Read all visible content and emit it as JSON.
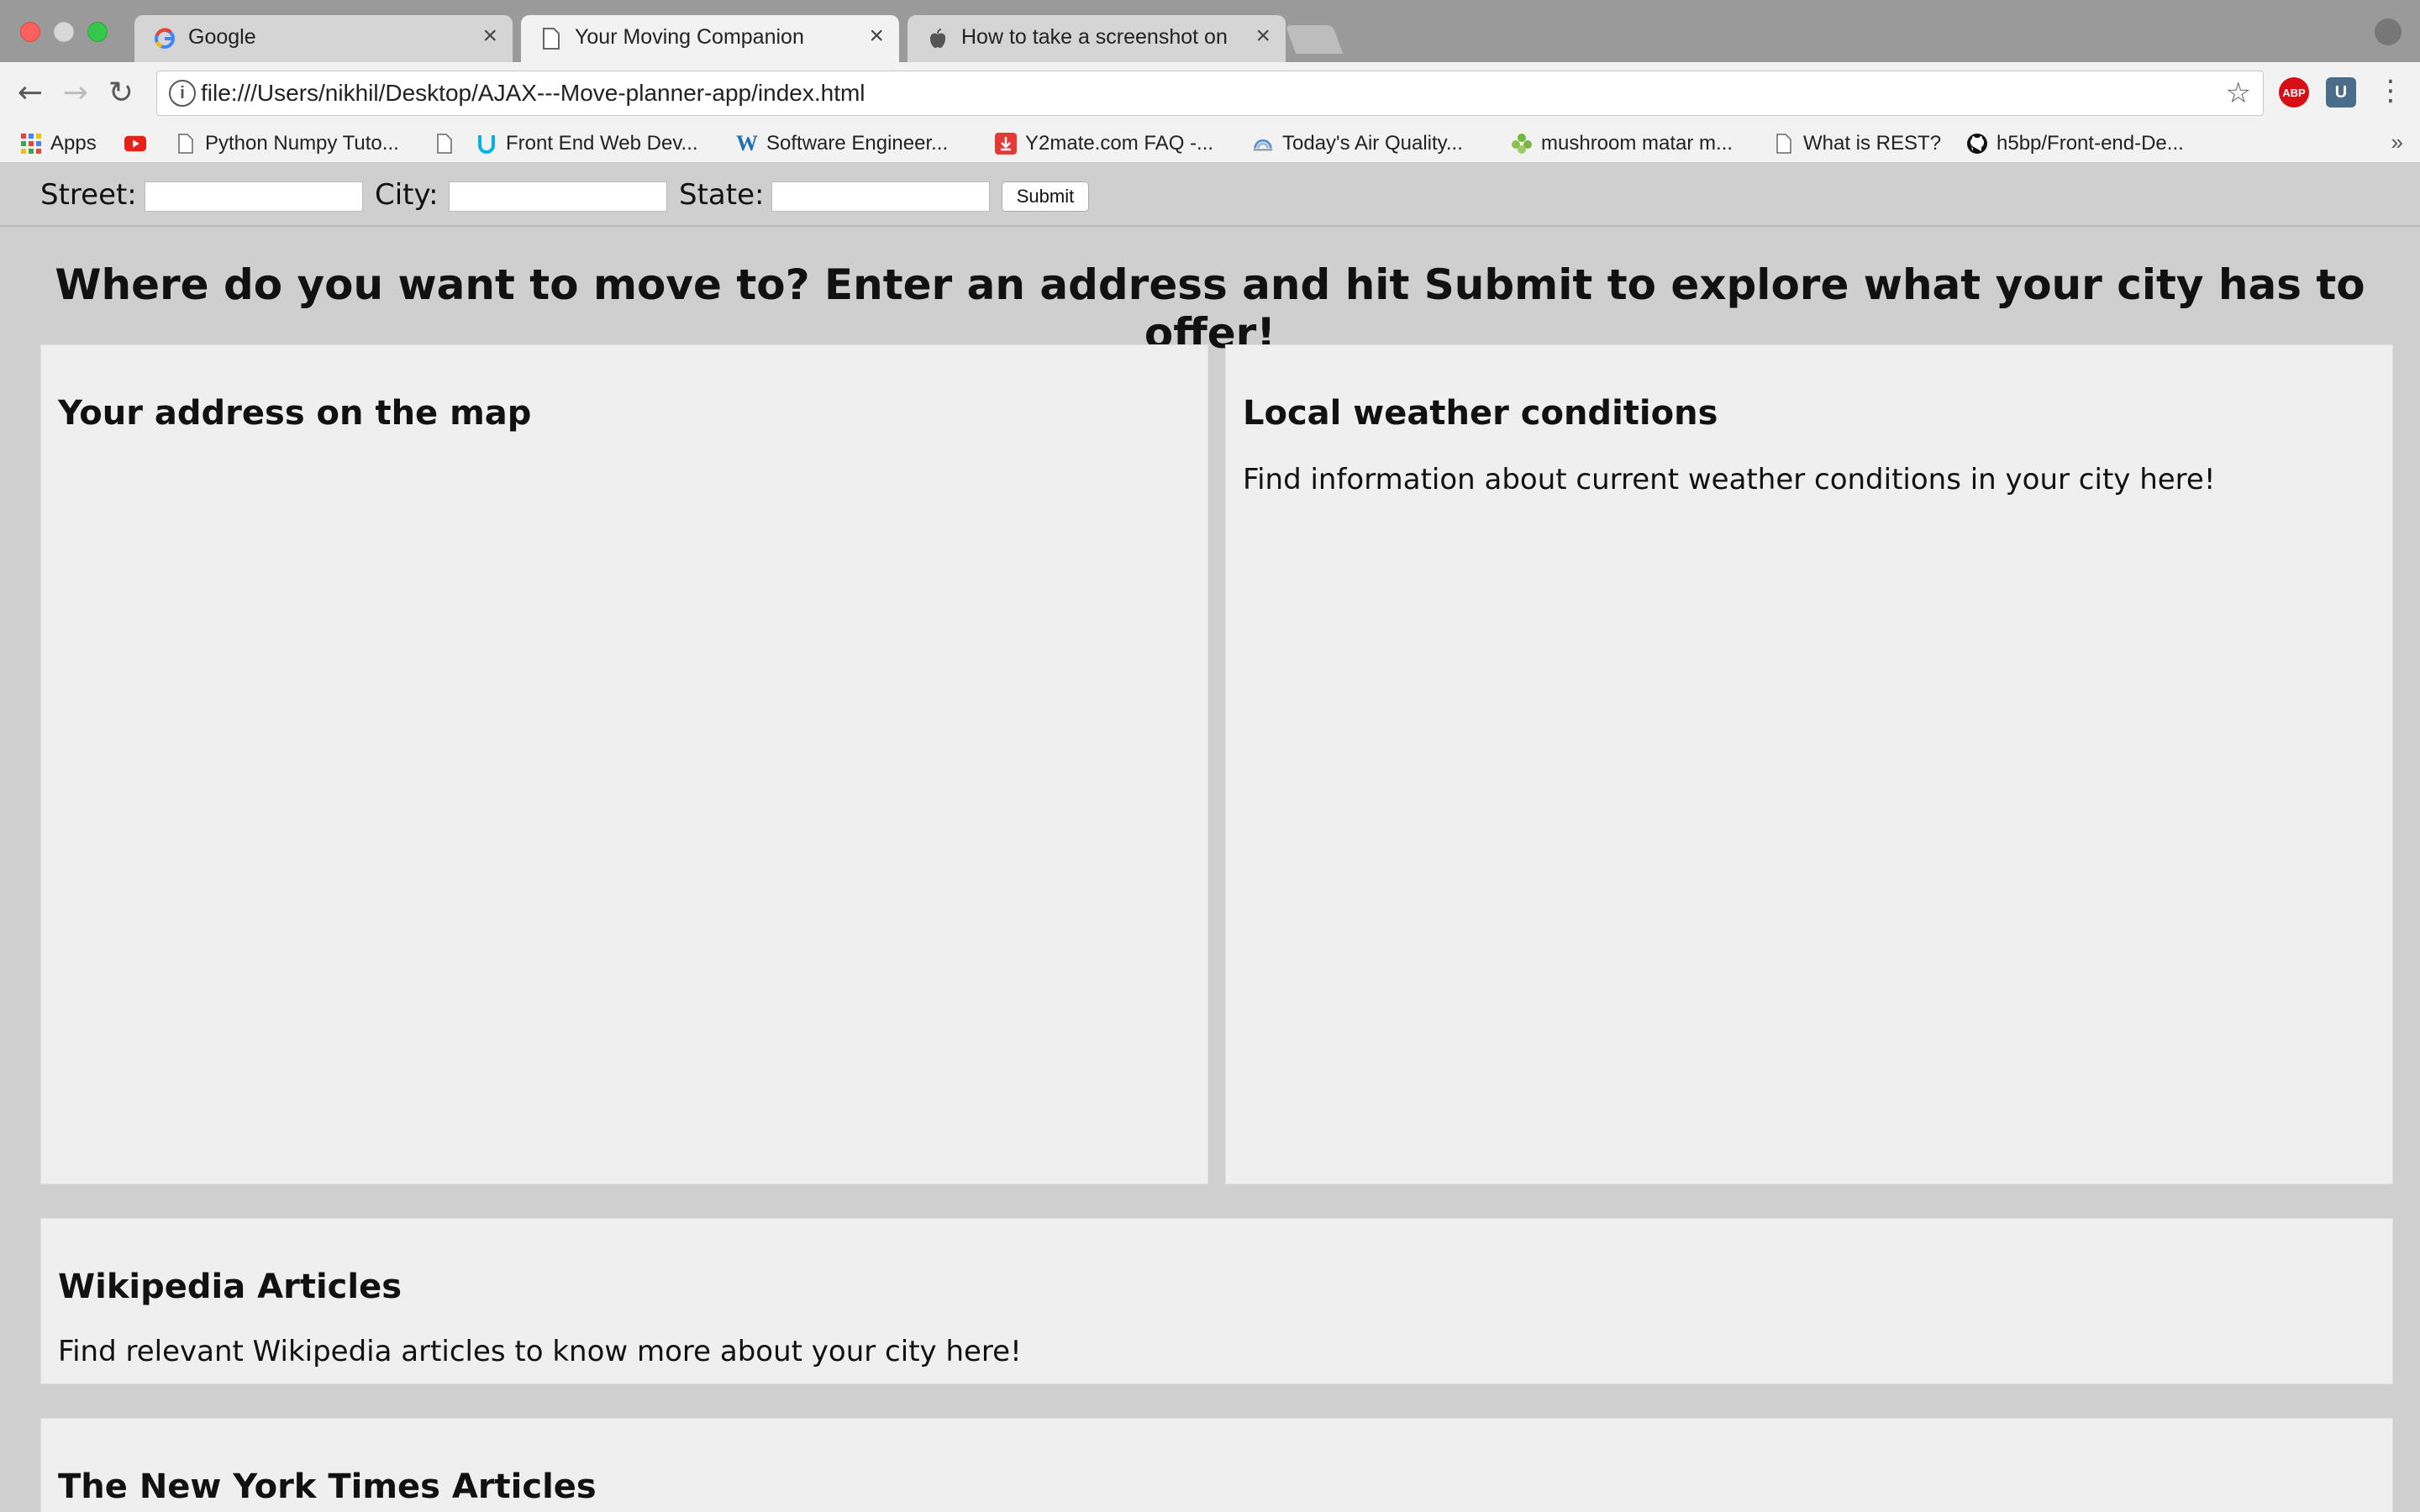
{
  "browser": {
    "tabs": [
      {
        "title": "Google",
        "favicon": "google-g-icon"
      },
      {
        "title": "Your Moving Companion",
        "favicon": "page-icon"
      },
      {
        "title": "How to take a screenshot on y",
        "favicon": "apple-icon"
      }
    ],
    "address_bar": {
      "url": "file:///Users/nikhil/Desktop/AJAX---Move-planner-app/index.html"
    },
    "bookmarks": [
      {
        "label": "Apps",
        "icon": "apps-grid-icon"
      },
      {
        "label": "",
        "icon": "youtube-icon"
      },
      {
        "label": "Python Numpy Tuto...",
        "icon": "page-icon"
      },
      {
        "label": "",
        "icon": "page-icon"
      },
      {
        "label": "Front End Web Dev...",
        "icon": "udacity-icon"
      },
      {
        "label": "Software Engineer...",
        "icon": "w-icon"
      },
      {
        "label": "Y2mate.com FAQ -...",
        "icon": "download-icon"
      },
      {
        "label": "Today's Air Quality...",
        "icon": "air-quality-icon"
      },
      {
        "label": "mushroom matar m...",
        "icon": "leaf-icon"
      },
      {
        "label": "What is REST?",
        "icon": "page-icon"
      },
      {
        "label": "h5bp/Front-end-De...",
        "icon": "github-icon"
      }
    ],
    "bookmarks_more": "»"
  },
  "form": {
    "street_label": "Street:",
    "city_label": "City:",
    "state_label": "State:",
    "street_value": "",
    "city_value": "",
    "state_value": "",
    "submit_label": "Submit"
  },
  "headline": "Where do you want to move to? Enter an address and hit Submit to explore what your city has to offer!",
  "panels": {
    "map": {
      "title": "Your address on the map"
    },
    "weather": {
      "title": "Local weather conditions",
      "text": "Find information about current weather conditions in your city here!"
    },
    "wikipedia": {
      "title": "Wikipedia Articles",
      "text": "Find relevant Wikipedia articles to know more about your city here!"
    },
    "nyt": {
      "title": "The New York Times Articles"
    }
  }
}
